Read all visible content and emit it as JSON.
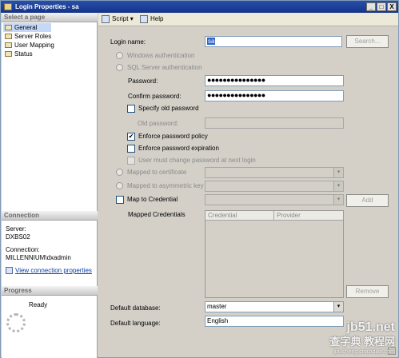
{
  "window": {
    "title": "Login Properties - sa",
    "buttons": {
      "minimize": "_",
      "maximize": "□",
      "close": "X"
    }
  },
  "sidebar": {
    "select_page_header": "Select a page",
    "pages": [
      {
        "label": "General",
        "selected": true
      },
      {
        "label": "Server Roles",
        "selected": false
      },
      {
        "label": "User Mapping",
        "selected": false
      },
      {
        "label": "Status",
        "selected": false
      }
    ],
    "connection_header": "Connection",
    "server_label": "Server:",
    "server_value": "DXBS02",
    "connection_label": "Connection:",
    "connection_value": "MILLENNIUM\\dxadmin",
    "view_connection_link": "View connection properties",
    "progress_header": "Progress",
    "progress_status": "Ready"
  },
  "toolbar": {
    "script_label": "Script",
    "help_label": "Help",
    "dropdown_arrow": "▾"
  },
  "form": {
    "login_name_label": "Login name:",
    "login_name_value": "sa",
    "search_button": "Search...",
    "windows_auth": "Windows authentication",
    "sql_auth": "SQL Server authentication",
    "password_label": "Password:",
    "password_value": "●●●●●●●●●●●●●●●",
    "confirm_label": "Confirm password:",
    "confirm_value": "●●●●●●●●●●●●●●●",
    "specify_old_label": "Specify old password",
    "old_password_label": "Old password:",
    "enforce_policy_label": "Enforce password policy",
    "enforce_policy_checked": true,
    "enforce_expiration_label": "Enforce password expiration",
    "must_change_label": "User must change password at next login",
    "mapped_cert_label": "Mapped to certificate",
    "mapped_asym_label": "Mapped to asymmetric key",
    "map_credential_label": "Map to Credential",
    "add_button": "Add",
    "mapped_credentials_label": "Mapped Credentials",
    "grid_columns": [
      "Credential",
      "Provider"
    ],
    "remove_button": "Remove",
    "default_db_label": "Default database:",
    "default_db_value": "master",
    "default_lang_label": "Default language:",
    "default_lang_value": "English",
    "checkmark": "✔"
  },
  "watermark": {
    "site": "jb51.net",
    "cn": "查字典 教程网",
    "url": "jiaocheng.chazidian.com"
  }
}
